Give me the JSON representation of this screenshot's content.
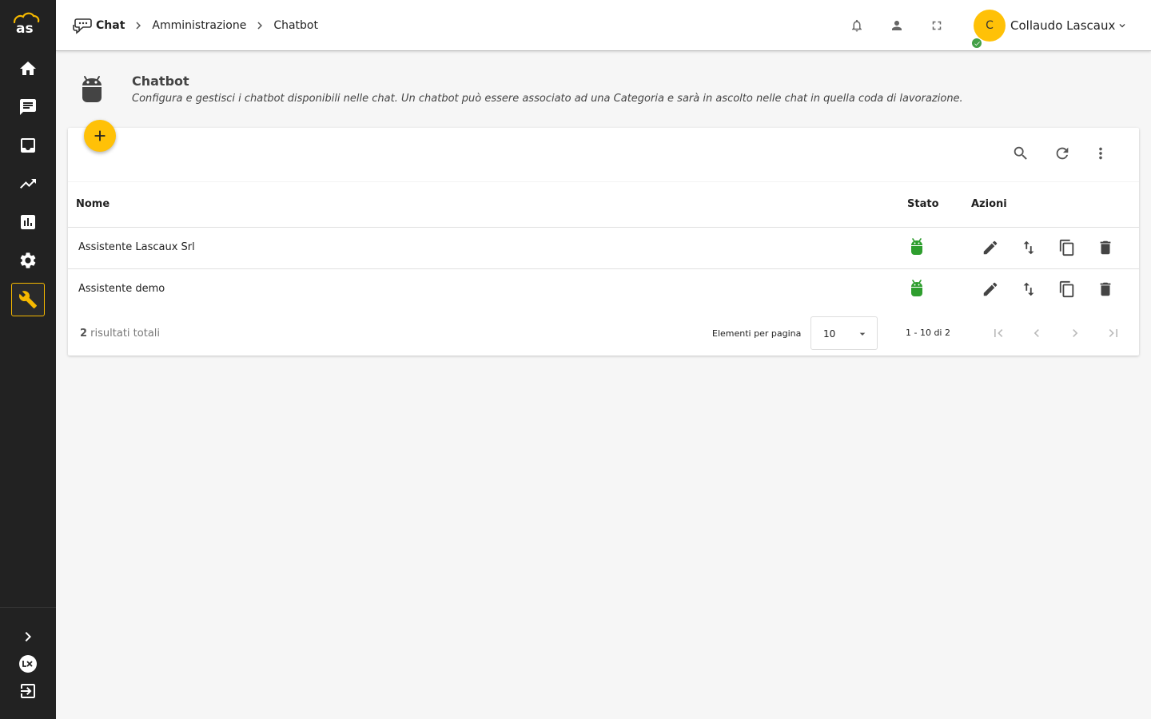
{
  "app": {
    "logo_text": "as"
  },
  "breadcrumb": {
    "items": [
      "Chat",
      "Amministrazione",
      "Chatbot"
    ]
  },
  "user": {
    "initial": "C",
    "name": "Collaudo Lascaux"
  },
  "page": {
    "title": "Chatbot",
    "description": "Configura e gestisci i chatbot disponibili nelle chat. Un chatbot può essere associato ad una Categoria e sarà in ascolto nelle chat in quella coda di lavorazione."
  },
  "table": {
    "columns": {
      "name": "Nome",
      "status": "Stato",
      "actions": "Azioni"
    },
    "rows": [
      {
        "name": "Assistente Lascaux Srl",
        "status": "active"
      },
      {
        "name": "Assistente demo",
        "status": "active"
      }
    ]
  },
  "footer": {
    "total_count": "2",
    "total_label": " risultati totali",
    "per_page_label": "Elementi per pagina",
    "per_page_value": "10",
    "range": "1 - 10 di 2"
  },
  "colors": {
    "accent": "#ffc107",
    "sidebar": "#222222",
    "status_active": "#2e9e2e",
    "online": "#43a047"
  }
}
